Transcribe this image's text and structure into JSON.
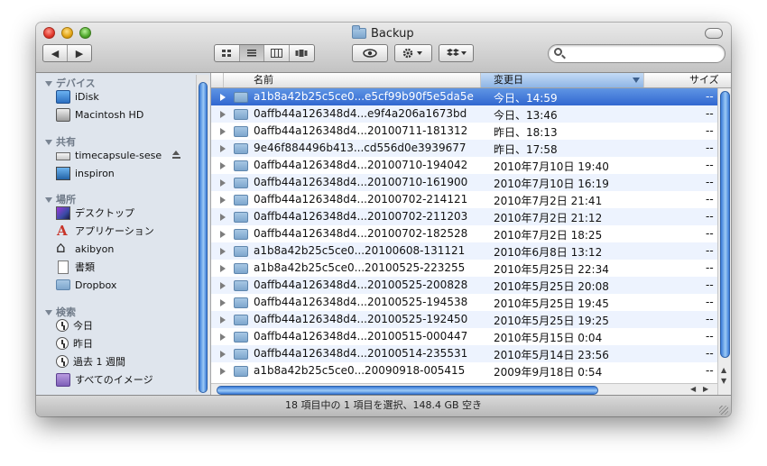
{
  "window": {
    "title": "Backup",
    "status": "18 項目中の 1 項目を選択、148.4 GB 空き"
  },
  "toolbar": {
    "back_icon": "◀",
    "forward_icon": "▶",
    "view_icon_view": "icon-view-icon",
    "view_list": "list-view-icon",
    "view_columns": "column-view-icon",
    "view_coverflow": "coverflow-view-icon",
    "quicklook_icon": "eye-icon",
    "action_icon": "gear-icon",
    "dropbox_icon": "dropbox-icon",
    "search_placeholder": ""
  },
  "sidebar": {
    "sections": [
      {
        "title": "デバイス",
        "items": [
          {
            "label": "iDisk",
            "icon": "idisk-icon"
          },
          {
            "label": "Macintosh HD",
            "icon": "harddisk-icon"
          }
        ]
      },
      {
        "title": "共有",
        "items": [
          {
            "label": "timecapsule-sese",
            "icon": "network-drive-icon"
          },
          {
            "label": "inspiron",
            "icon": "monitor-icon"
          }
        ]
      },
      {
        "title": "場所",
        "items": [
          {
            "label": "デスクトップ",
            "icon": "desktop-icon"
          },
          {
            "label": "アプリケーション",
            "icon": "applications-icon"
          },
          {
            "label": "akibyon",
            "icon": "home-icon"
          },
          {
            "label": "書類",
            "icon": "documents-icon"
          },
          {
            "label": "Dropbox",
            "icon": "dropbox-folder-icon"
          }
        ]
      },
      {
        "title": "検索",
        "items": [
          {
            "label": "今日",
            "icon": "clock-icon"
          },
          {
            "label": "昨日",
            "icon": "clock-icon"
          },
          {
            "label": "過去 1 週間",
            "icon": "clock-icon"
          },
          {
            "label": "すべてのイメージ",
            "icon": "images-icon"
          }
        ]
      }
    ]
  },
  "columns": {
    "name": "名前",
    "date": "変更日",
    "size": "サイズ"
  },
  "files": [
    {
      "name": "a1b8a42b25c5ce0...e5cf99b90f5e5da5e",
      "date": "今日、14:59",
      "size": "--",
      "selected": true
    },
    {
      "name": "0affb44a126348d4...e9f4a206a1673bd",
      "date": "今日、13:46",
      "size": "--"
    },
    {
      "name": "0affb44a126348d4...20100711-181312",
      "date": "昨日、18:13",
      "size": "--"
    },
    {
      "name": "9e46f884496b413...cd556d0e3939677",
      "date": "昨日、17:58",
      "size": "--"
    },
    {
      "name": "0affb44a126348d4...20100710-194042",
      "date": "2010年7月10日 19:40",
      "size": "--"
    },
    {
      "name": "0affb44a126348d4...20100710-161900",
      "date": "2010年7月10日 16:19",
      "size": "--"
    },
    {
      "name": "0affb44a126348d4...20100702-214121",
      "date": "2010年7月2日 21:41",
      "size": "--"
    },
    {
      "name": "0affb44a126348d4...20100702-211203",
      "date": "2010年7月2日 21:12",
      "size": "--"
    },
    {
      "name": "0affb44a126348d4...20100702-182528",
      "date": "2010年7月2日 18:25",
      "size": "--"
    },
    {
      "name": "a1b8a42b25c5ce0...20100608-131121",
      "date": "2010年6月8日 13:12",
      "size": "--"
    },
    {
      "name": "a1b8a42b25c5ce0...20100525-223255",
      "date": "2010年5月25日 22:34",
      "size": "--"
    },
    {
      "name": "0affb44a126348d4...20100525-200828",
      "date": "2010年5月25日 20:08",
      "size": "--"
    },
    {
      "name": "0affb44a126348d4...20100525-194538",
      "date": "2010年5月25日 19:45",
      "size": "--"
    },
    {
      "name": "0affb44a126348d4...20100525-192450",
      "date": "2010年5月25日 19:25",
      "size": "--"
    },
    {
      "name": "0affb44a126348d4...20100515-000447",
      "date": "2010年5月15日 0:04",
      "size": "--"
    },
    {
      "name": "0affb44a126348d4...20100514-235531",
      "date": "2010年5月14日 23:56",
      "size": "--"
    },
    {
      "name": "a1b8a42b25c5ce0...20090918-005415",
      "date": "2009年9月18日 0:54",
      "size": "--"
    }
  ]
}
